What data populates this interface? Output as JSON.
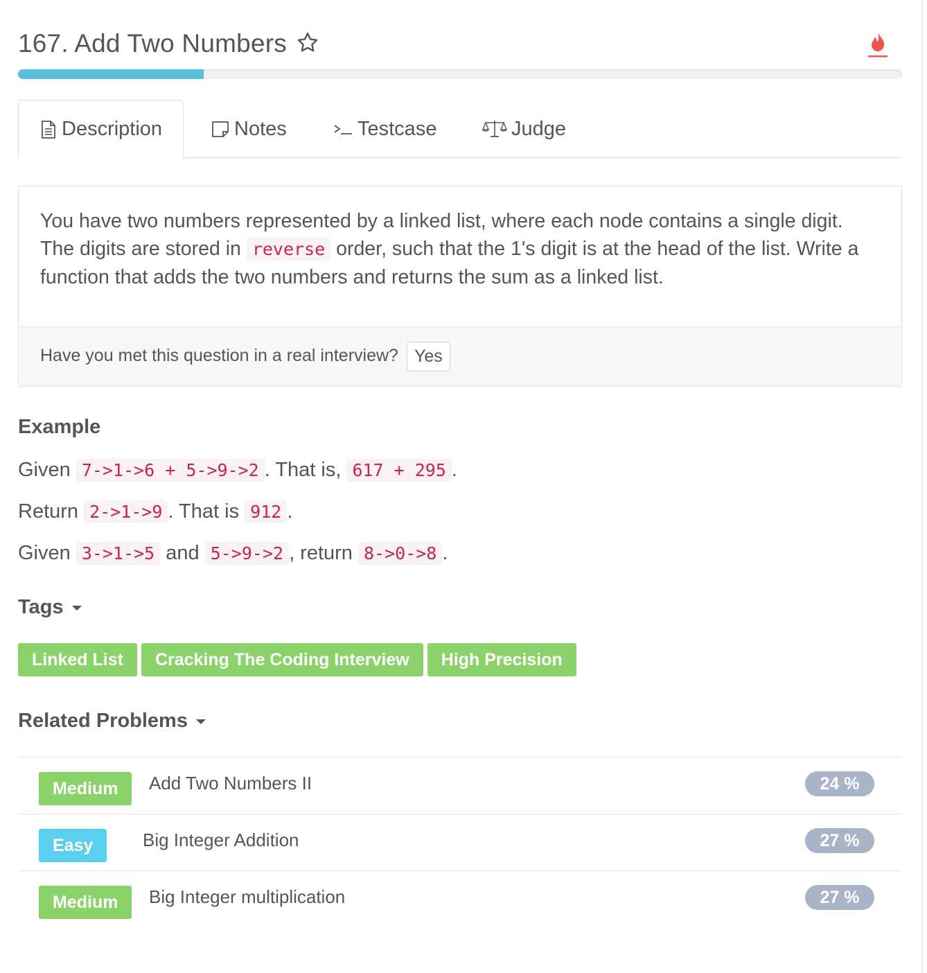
{
  "header": {
    "title": "167. Add Two Numbers",
    "progress_percent": 21
  },
  "tabs": [
    {
      "label": "Description",
      "icon": "document-icon",
      "active": true
    },
    {
      "label": "Notes",
      "icon": "note-icon",
      "active": false
    },
    {
      "label": "Testcase",
      "icon": "terminal-icon",
      "active": false
    },
    {
      "label": "Judge",
      "icon": "scale-icon",
      "active": false
    }
  ],
  "description": {
    "text_1": "You have two numbers represented by a linked list, where each node contains a single digit. The digits are stored in",
    "code": "reverse",
    "text_2": "order, such that the 1's digit is at the head of the list. Write a function that adds the two numbers and returns the sum as a linked list.",
    "interview_question": "Have you met this question in a real interview?",
    "yes_label": "Yes"
  },
  "example": {
    "title": "Example",
    "line1": {
      "given": "Given",
      "code1": "7->1->6 + 5->9->2",
      "mid": ". That is,",
      "code2": "617 + 295",
      "end": "."
    },
    "line2": {
      "ret": "Return",
      "code1": "2->1->9",
      "mid": ". That is",
      "code2": "912",
      "end": "."
    },
    "line3": {
      "given": "Given",
      "code1": "3->1->5",
      "and": "and",
      "code2": "5->9->2",
      "ret": ", return",
      "code3": "8->0->8",
      "end": "."
    }
  },
  "tags": {
    "title": "Tags",
    "items": [
      "Linked List",
      "Cracking The Coding Interview",
      "High Precision"
    ]
  },
  "related": {
    "title": "Related Problems",
    "items": [
      {
        "level": "Medium",
        "name": "Add Two Numbers II",
        "percent": "24 %"
      },
      {
        "level": "Easy",
        "name": "Big Integer Addition",
        "percent": "27 %"
      },
      {
        "level": "Medium",
        "name": "Big Integer multiplication",
        "percent": "27 %"
      }
    ]
  },
  "colors": {
    "accent": "#5bc0de",
    "tag_green": "#8cd26a",
    "easy_blue": "#5bd0ee",
    "flame_red": "#f0544f",
    "code_red": "#c7254e",
    "percent_badge": "#aab4c8"
  }
}
